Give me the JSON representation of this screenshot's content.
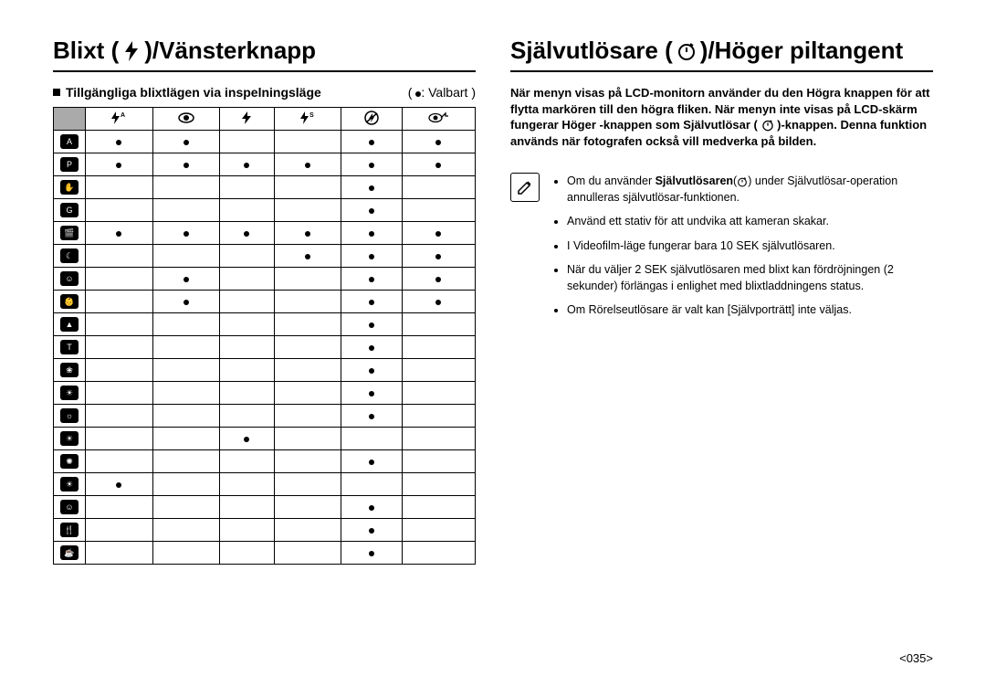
{
  "page_number": "035",
  "left": {
    "title_before": "Blixt (",
    "title_after": ")/Vänsterknapp",
    "title_icon": "flash",
    "subheading": "Tillgängliga blixtlägen via inspelningsläge",
    "legend_bullet": "●",
    "legend_label": ": Valbart",
    "flash_columns": [
      "flash-auto",
      "redeye",
      "flash-fill",
      "flash-slow",
      "flash-off",
      "redeye-fix"
    ],
    "mode_rows": [
      "auto",
      "program",
      "dis",
      "guide",
      "scene",
      "night",
      "portrait",
      "children",
      "landscape",
      "text",
      "closeup",
      "sunset",
      "dawn",
      "backlight",
      "fireworks",
      "beach",
      "selfshot",
      "food",
      "cafe"
    ],
    "chart_data": {
      "type": "table",
      "title": "Tillgängliga blixtlägen via inspelningsläge",
      "columns": [
        "flash-auto",
        "redeye",
        "flash-fill",
        "flash-slow",
        "flash-off",
        "redeye-fix"
      ],
      "rows": [
        "auto",
        "program",
        "dis",
        "guide",
        "scene",
        "night",
        "portrait",
        "children",
        "landscape",
        "text",
        "closeup",
        "sunset",
        "dawn",
        "backlight",
        "fireworks",
        "beach",
        "selfshot",
        "food",
        "cafe"
      ],
      "matrix": [
        [
          1,
          1,
          0,
          0,
          1,
          1
        ],
        [
          1,
          1,
          1,
          1,
          1,
          1
        ],
        [
          0,
          0,
          0,
          0,
          1,
          0
        ],
        [
          0,
          0,
          0,
          0,
          1,
          0
        ],
        [
          1,
          1,
          1,
          1,
          1,
          1
        ],
        [
          0,
          0,
          0,
          1,
          1,
          1
        ],
        [
          0,
          1,
          0,
          0,
          1,
          1
        ],
        [
          0,
          1,
          0,
          0,
          1,
          1
        ],
        [
          0,
          0,
          0,
          0,
          1,
          0
        ],
        [
          0,
          0,
          0,
          0,
          1,
          0
        ],
        [
          0,
          0,
          0,
          0,
          1,
          0
        ],
        [
          0,
          0,
          0,
          0,
          1,
          0
        ],
        [
          0,
          0,
          0,
          0,
          1,
          0
        ],
        [
          0,
          0,
          1,
          0,
          0,
          0
        ],
        [
          0,
          0,
          0,
          0,
          1,
          0
        ],
        [
          1,
          0,
          0,
          0,
          0,
          0
        ],
        [
          0,
          0,
          0,
          0,
          1,
          0
        ],
        [
          0,
          0,
          0,
          0,
          1,
          0
        ],
        [
          0,
          0,
          0,
          0,
          1,
          0
        ]
      ]
    }
  },
  "right": {
    "title_before": "Självutlösare (",
    "title_after": ")/Höger piltangent",
    "title_icon": "timer",
    "paragraph_parts": [
      "När menyn visas på LCD-monitorn använder du den Högra knappen för att flytta markören till den högra fliken. När menyn inte visas på LCD-skärm fungerar Höger -knappen som Självutlösar (",
      ")-knappen. Denna funktion används när fotografen också vill medverka på bilden."
    ],
    "note_icon": "pencil",
    "notes": [
      {
        "pre": "Om du använder ",
        "bold": "Självutlösaren",
        "post_icon": "timer",
        "post": " under Självutlösar-operation annulleras självutlösar-funktionen."
      },
      {
        "text": "Använd ett stativ för att undvika att kameran skakar."
      },
      {
        "text": "I Videofilm-läge fungerar bara 10 SEK självutlösaren."
      },
      {
        "text": "När du väljer 2 SEK självutlösaren med blixt kan fördröjningen (2 sekunder) förlängas i enlighet med blixtladdningens status."
      },
      {
        "text": "Om Rörelseutlösare är valt kan [Självporträtt] inte väljas."
      }
    ]
  }
}
